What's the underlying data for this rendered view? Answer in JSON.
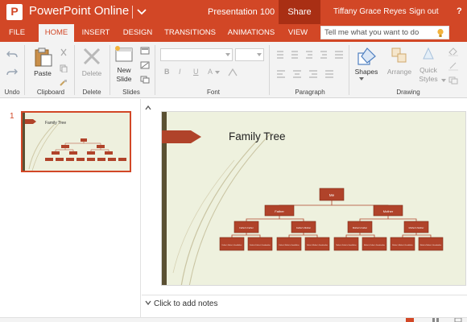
{
  "app": {
    "logo_letter": "P",
    "name": "PowerPoint Online",
    "document": "Presentation 100",
    "share": "Share",
    "user": "Tiffany Grace Reyes",
    "sign_out": "Sign out",
    "help": "?",
    "accent": "#d24726"
  },
  "tabs": [
    {
      "label": "FILE"
    },
    {
      "label": "HOME"
    },
    {
      "label": "INSERT"
    },
    {
      "label": "DESIGN"
    },
    {
      "label": "TRANSITIONS"
    },
    {
      "label": "ANIMATIONS"
    },
    {
      "label": "VIEW"
    }
  ],
  "active_tab": "HOME",
  "tell_me": "Tell me what you want to do",
  "ribbon": {
    "paste": "Paste",
    "delete": "Delete",
    "new_slide_line1": "New",
    "new_slide_line2": "Slide",
    "shapes": "Shapes",
    "arrange": "Arrange",
    "quick_styles_line1": "Quick",
    "quick_styles_line2": "Styles",
    "groups": {
      "undo": "Undo",
      "clipboard": "Clipboard",
      "delete": "Delete",
      "slides": "Slides",
      "font": "Font",
      "paragraph": "Paragraph",
      "drawing": "Drawing"
    },
    "format": {
      "bold": "B",
      "italic": "I",
      "underline": "U",
      "color": "A"
    }
  },
  "thumbnails": [
    {
      "number": "1",
      "title": "Family Tree"
    }
  ],
  "slide": {
    "title": "Family Tree",
    "chart": {
      "root": "Me",
      "level1": [
        "Father",
        "Mother"
      ],
      "level2": [
        "Father's Father",
        "Father's Mother",
        "Mother's Father",
        "Mother's Mother"
      ],
      "level3": [
        "Father's Father's Grandfather",
        "Father's Father's Grandmother",
        "Father's Mother's Grandfather",
        "Father's Mother's Grandmother",
        "Mother's Father's Grandfather",
        "Mother's Father's Grandmother",
        "Mother's Mother's Grandfather",
        "Mother's Mother's Grandmother"
      ]
    }
  },
  "notes_placeholder": "Click to add notes"
}
